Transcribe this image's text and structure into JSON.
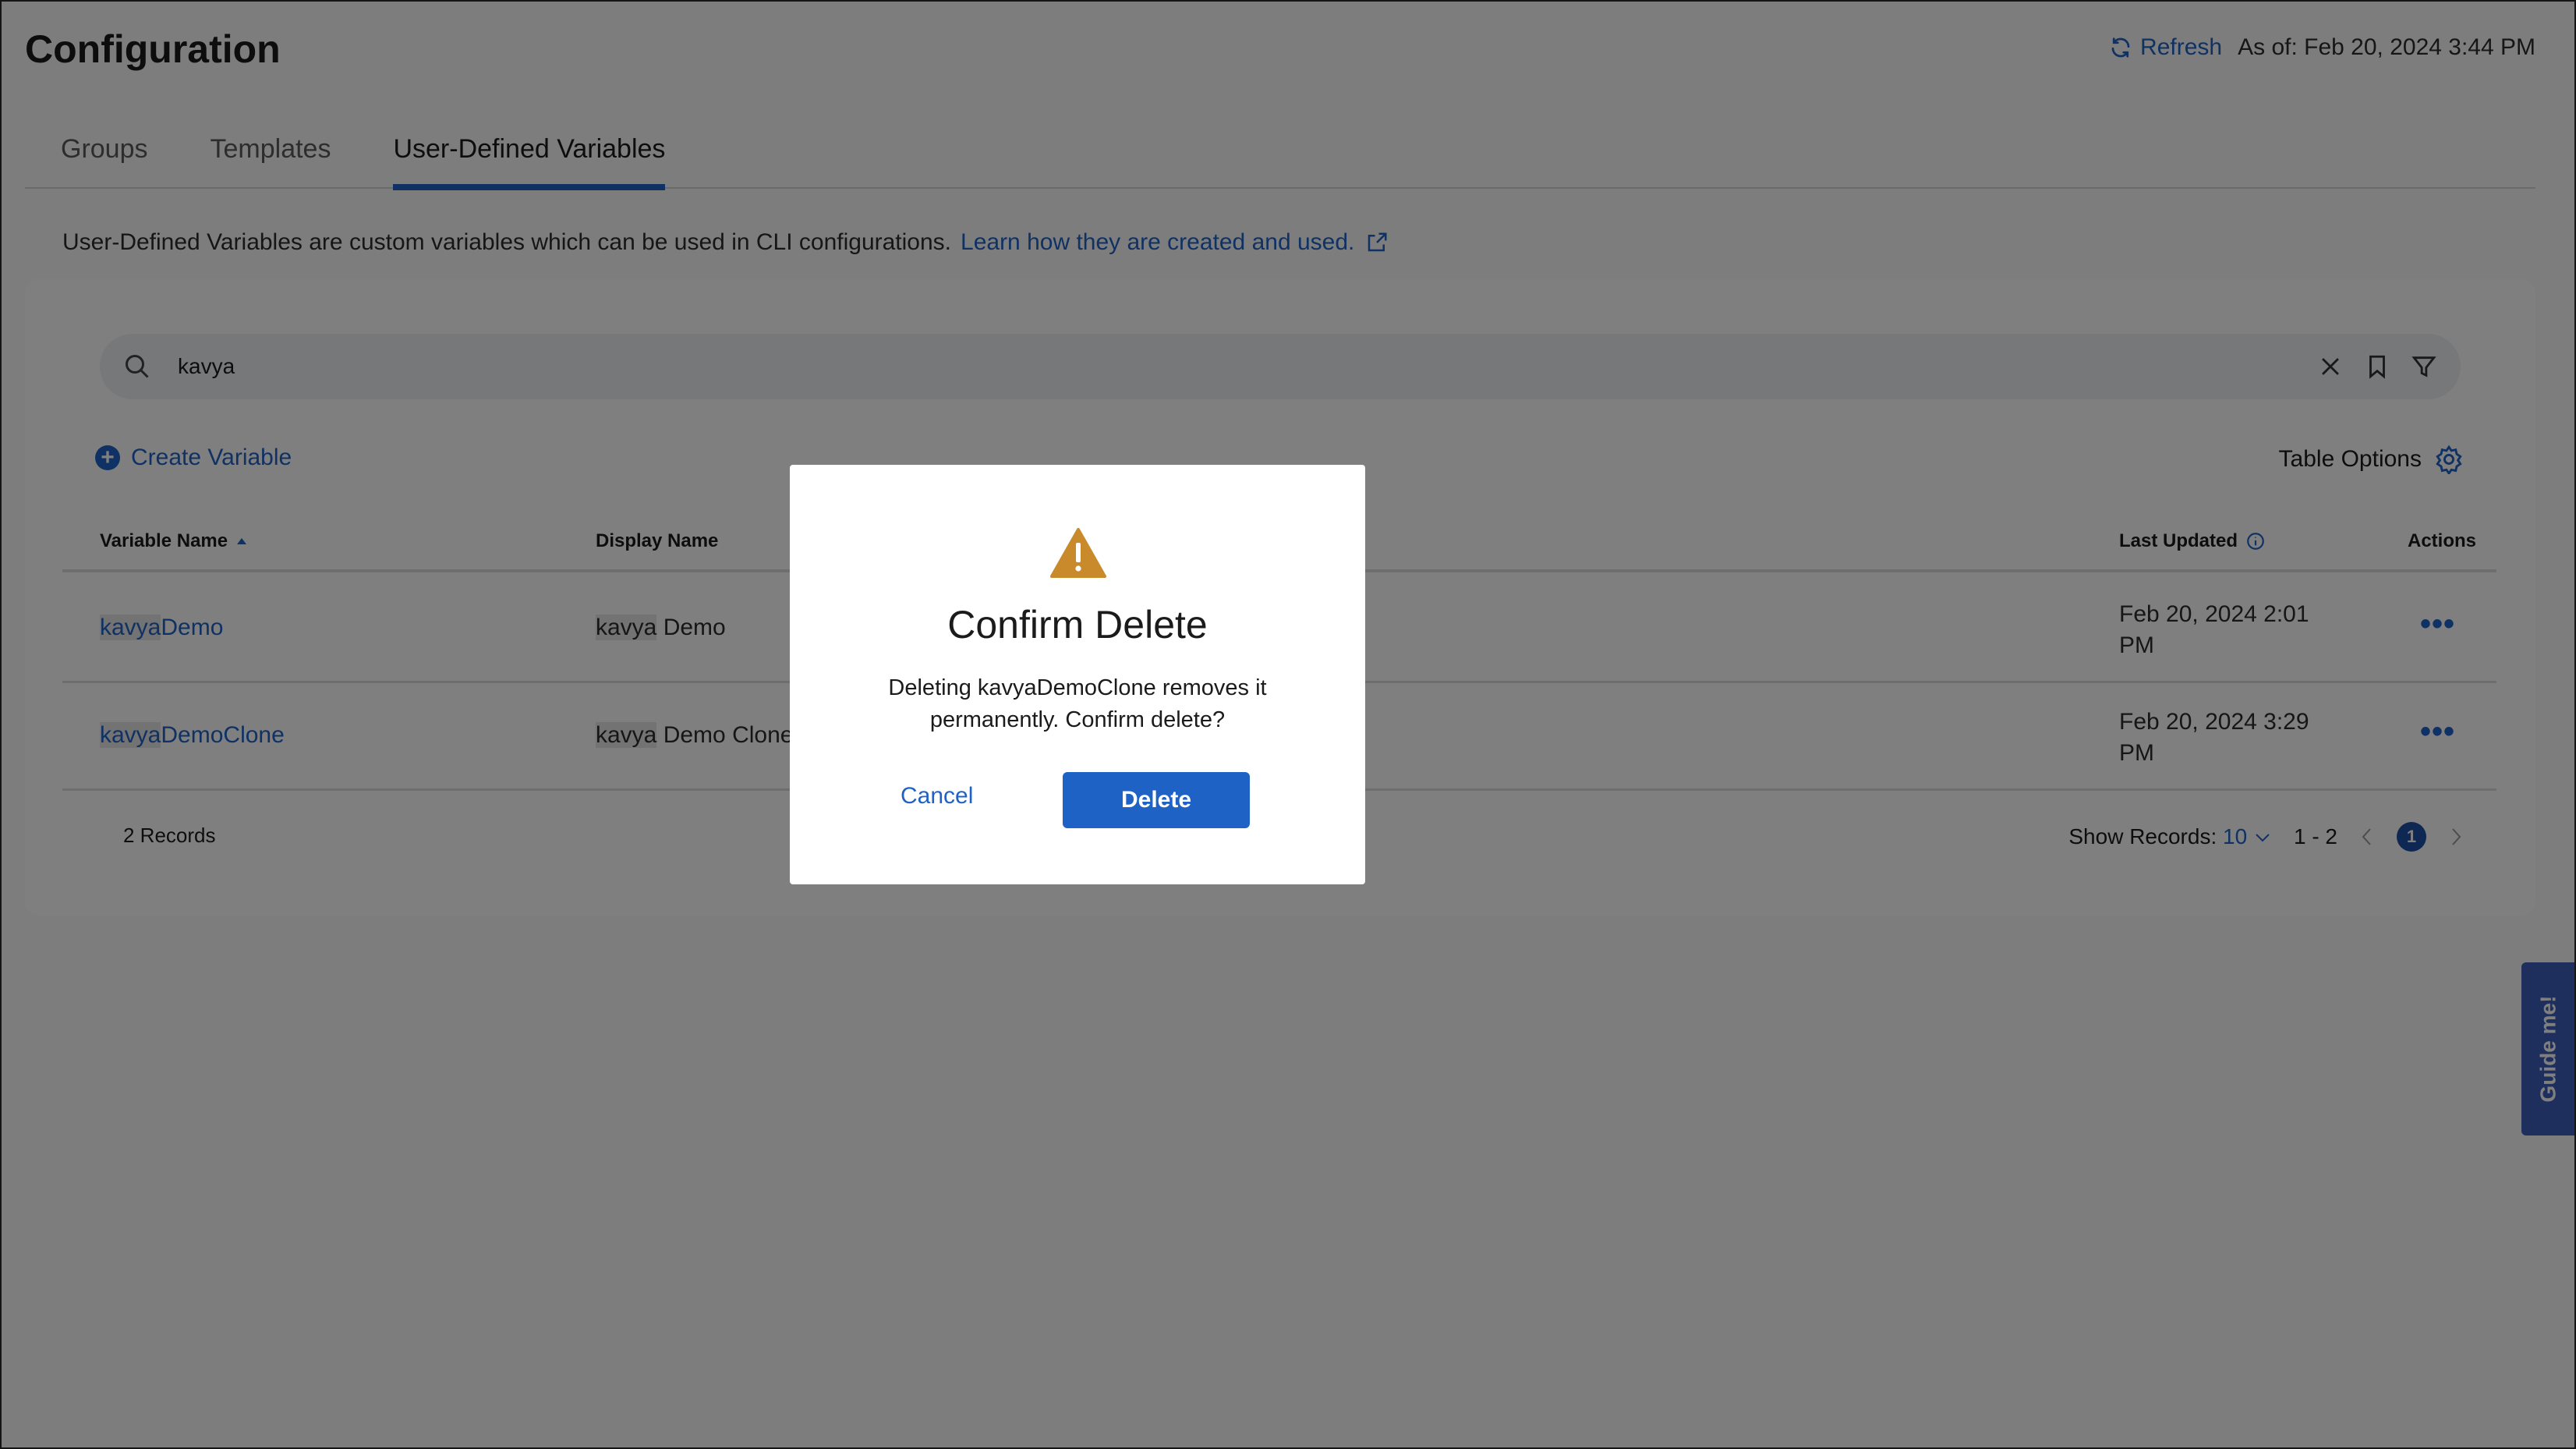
{
  "header": {
    "title": "Configuration",
    "refresh_label": "Refresh",
    "as_of": "As of: Feb 20, 2024 3:44 PM"
  },
  "tabs": [
    {
      "label": "Groups"
    },
    {
      "label": "Templates"
    },
    {
      "label": "User-Defined Variables",
      "active": true
    }
  ],
  "description": {
    "text": "User-Defined Variables are custom variables which can be used in CLI configurations.",
    "link": "Learn how they are created and used."
  },
  "search": {
    "value": "kavya"
  },
  "toolbar": {
    "create_label": "Create Variable",
    "table_options_label": "Table Options"
  },
  "table": {
    "columns": [
      "Variable Name",
      "Display Name",
      "Last Updated",
      "Actions"
    ],
    "rows": [
      {
        "var_highlight": "kavya",
        "var_rest": "Demo",
        "disp_highlight": "kavya",
        "disp_rest": " Demo",
        "last_updated_1": "Feb 20, 2024 2:01",
        "last_updated_2": "PM",
        "actions": "•••"
      },
      {
        "var_highlight": "kavya",
        "var_rest": "DemoClone",
        "disp_highlight": "kavya",
        "disp_rest": " Demo Clone",
        "last_updated_1": "Feb 20, 2024 3:29",
        "last_updated_2": "PM",
        "actions": "•••"
      }
    ]
  },
  "footer": {
    "records": "2 Records",
    "show_records_label": "Show Records:",
    "show_records_value": "10",
    "range": "1 - 2",
    "current_page": "1"
  },
  "guide": {
    "label": "Guide me!"
  },
  "modal": {
    "title": "Confirm Delete",
    "message": "Deleting kavyaDemoClone removes it permanently. Confirm delete?",
    "cancel_label": "Cancel",
    "delete_label": "Delete"
  },
  "colors": {
    "accent": "#1e62c6",
    "warning": "#c98a2b",
    "overlay": "rgba(0,0,0,0.5)"
  }
}
